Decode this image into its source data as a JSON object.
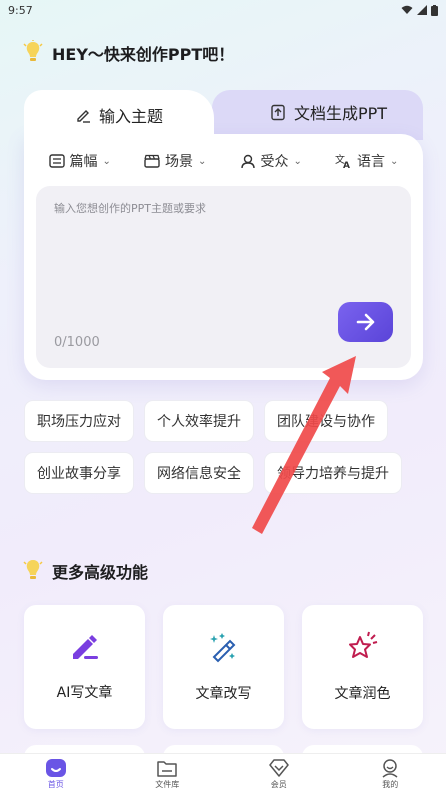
{
  "status_bar": {
    "time": "9:57"
  },
  "hero": {
    "title": "HEY～快来创作PPT吧！"
  },
  "tabs": {
    "active_label": "输入主题",
    "inactive_label": "文档生成PPT"
  },
  "options": [
    {
      "label": "篇幅"
    },
    {
      "label": "场景"
    },
    {
      "label": "受众"
    },
    {
      "label": "语言"
    }
  ],
  "input": {
    "placeholder": "输入您想创作的PPT主题或要求",
    "counter": "0/1000"
  },
  "suggestions": {
    "row1": [
      "职场压力应对",
      "个人效率提升",
      "团队建设与协作"
    ],
    "row2": [
      "创业故事分享",
      "网络信息安全",
      "领导力培养与提升"
    ]
  },
  "section": {
    "title": "更多高级功能"
  },
  "features": [
    {
      "label": "AI写文章",
      "icon": "pen-icon"
    },
    {
      "label": "文章改写",
      "icon": "magic-wand-icon"
    },
    {
      "label": "文章润色",
      "icon": "sparkle-star-icon"
    }
  ],
  "nav": [
    {
      "label": "首页",
      "icon": "home-icon"
    },
    {
      "label": "文件库",
      "icon": "folder-icon"
    },
    {
      "label": "会员",
      "icon": "diamond-icon"
    },
    {
      "label": "我的",
      "icon": "profile-icon"
    }
  ],
  "colors": {
    "accent": "#6a55e5",
    "tab_inactive": "#dcd9f7"
  }
}
